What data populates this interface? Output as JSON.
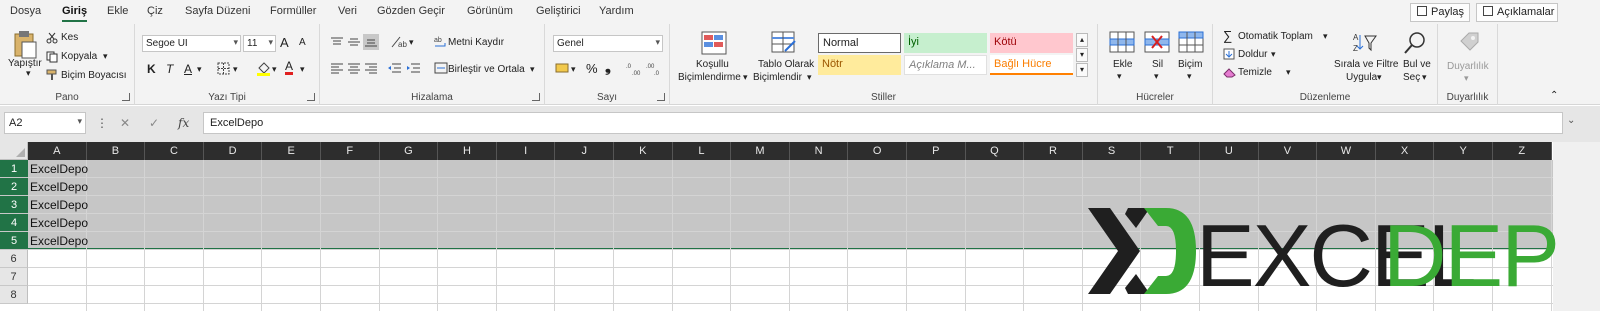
{
  "menu": {
    "tabs": [
      "Dosya",
      "Giriş",
      "Ekle",
      "Çiz",
      "Sayfa Düzeni",
      "Formüller",
      "Veri",
      "Gözden Geçir",
      "Görünüm",
      "Geliştirici",
      "Yardım"
    ],
    "active_tab": "Giriş",
    "share_label": "Paylaş",
    "comments_label": "Açıklamalar"
  },
  "ribbon": {
    "clipboard": {
      "paste_label": "Yapıştır",
      "cut_label": "Kes",
      "copy_label": "Kopyala",
      "format_painter_label": "Biçim Boyacısı",
      "group_label": "Pano"
    },
    "font": {
      "font_name": "Segoe UI",
      "font_size": "11",
      "bold": "K",
      "italic": "T",
      "underline": "A",
      "grow_label": "A",
      "shrink_label": "A",
      "font_color_label": "A",
      "group_label": "Yazı Tipi"
    },
    "alignment": {
      "wrap_label": "Metni Kaydır",
      "merge_label": "Birleştir ve Ortala",
      "group_label": "Hizalama"
    },
    "number": {
      "format": "Genel",
      "percent": "%",
      "comma": "⁹",
      "group_label": "Sayı"
    },
    "styles": {
      "conditional_line1": "Koşullu",
      "conditional_line2": "Biçimlendirme",
      "table_line1": "Tablo Olarak",
      "table_line2": "Biçimlendir",
      "gallery": [
        "Normal",
        "İyi",
        "Kötü",
        "Nötr",
        "Açıklama M...",
        "Bağlı Hücre"
      ],
      "group_label": "Stiller"
    },
    "cells": {
      "insert_label": "Ekle",
      "delete_label": "Sil",
      "format_label": "Biçim",
      "group_label": "Hücreler"
    },
    "editing": {
      "autosum_label": "Otomatik Toplam",
      "fill_label": "Doldur",
      "clear_label": "Temizle",
      "sort_line1": "Sırala ve Filtre",
      "sort_line2": "Uygula",
      "find_line1": "Bul ve",
      "find_line2": "Seç",
      "group_label": "Düzenleme"
    },
    "sensitivity": {
      "label": "Duyarlılık",
      "group_label": "Duyarlılık"
    }
  },
  "formula_bar": {
    "name_box": "A2",
    "fx": "fx",
    "content": "ExcelDepo"
  },
  "sheet": {
    "columns": [
      "A",
      "B",
      "C",
      "D",
      "E",
      "F",
      "G",
      "H",
      "I",
      "J",
      "K",
      "L",
      "M",
      "N",
      "O",
      "P",
      "Q",
      "R",
      "S",
      "T",
      "U",
      "V",
      "W",
      "X",
      "Y",
      "Z"
    ],
    "rows": [
      "1",
      "2",
      "3",
      "4",
      "5",
      "6",
      "7",
      "8"
    ],
    "cells_a": [
      "ExcelDepo",
      "ExcelDepo",
      "ExcelDepo",
      "ExcelDepo",
      "ExcelDepo"
    ]
  },
  "logo": {
    "part1": "EXCEL",
    "part2": "DEPO",
    "dark_color": "#1f1f1f",
    "green_color": "#3aaa35"
  },
  "colors": {
    "accent": "#217346",
    "header_dark": "#2d2d2d",
    "selection_gray": "#c6c6c6"
  }
}
